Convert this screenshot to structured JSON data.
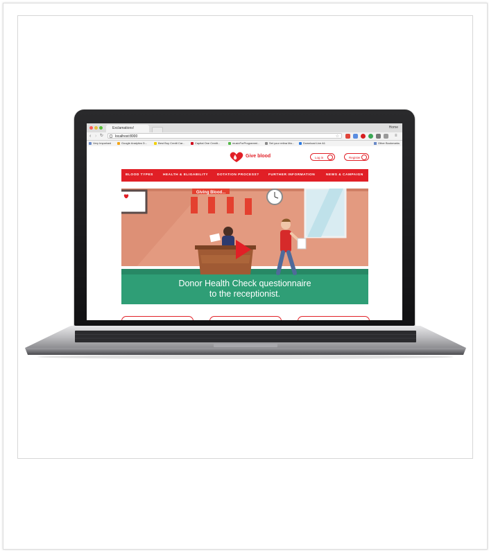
{
  "browser": {
    "tab_title": "Exclamations!",
    "url": "localhost:8000",
    "profile_name": "Home",
    "bookmarks": [
      {
        "label": "Very Important",
        "icon": "folder-icon",
        "color": "#6a8ac8"
      },
      {
        "label": "Google Analytics D...",
        "icon": "analytics-icon",
        "color": "#f4a416"
      },
      {
        "label": "Best Buy Credit Car...",
        "icon": "bestbuy-icon",
        "color": "#f2d100"
      },
      {
        "label": "Capital One Credit...",
        "icon": "capital-one-icon",
        "color": "#d0021b"
      },
      {
        "label": "musicForProgrammi...",
        "icon": "music-icon",
        "color": "#54b948"
      },
      {
        "label": "Set your retina Ma...",
        "icon": "link-icon",
        "color": "#888888"
      },
      {
        "label": "Download Live A1",
        "icon": "download-icon",
        "color": "#2a7ae2"
      }
    ],
    "other_bookmarks": "Other Bookmarks"
  },
  "site": {
    "brand": "Give blood",
    "brand_color": "#e11f26",
    "login_label": "Log in",
    "register_label": "Register",
    "nav": [
      "BLOOD TYPES",
      "HEALTH & ELIGABILITY",
      "DOTATION PROCESS?",
      "FURTHER INFORMATION",
      "NEWS & CAMPAIGN"
    ],
    "hero": {
      "poster_title": "Giving Blood...",
      "caption_line1": "Donor Health Check questionnaire",
      "caption_line2": "to the receptionist."
    }
  }
}
